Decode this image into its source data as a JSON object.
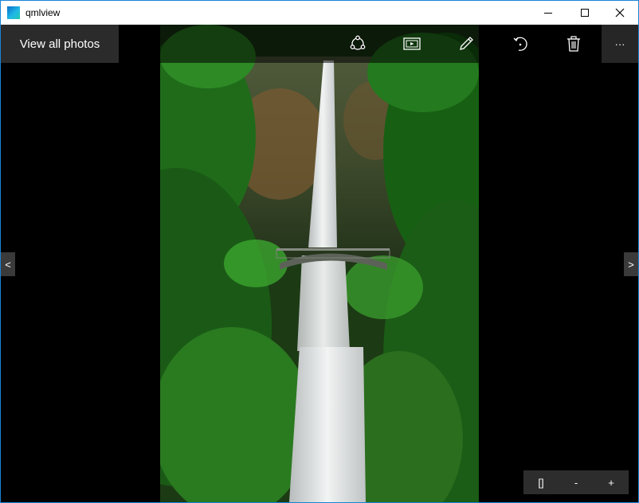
{
  "window": {
    "title": "qmlview",
    "controls": [
      "minimize",
      "maximize",
      "close"
    ]
  },
  "toolbar": {
    "view_all_label": "View all photos",
    "icons": [
      "share-icon",
      "slideshow-icon",
      "edit-icon",
      "rotate-icon",
      "delete-icon"
    ],
    "more_label": "···"
  },
  "navigation": {
    "prev_label": "<",
    "next_label": ">"
  },
  "zoom": {
    "fit_label": "[]",
    "zoom_out_label": "-",
    "zoom_in_label": "+"
  },
  "colors": {
    "window_border": "#1883d7",
    "canvas": "#000000",
    "toolbar_overlay": "rgba(0,0,0,0.55)"
  }
}
